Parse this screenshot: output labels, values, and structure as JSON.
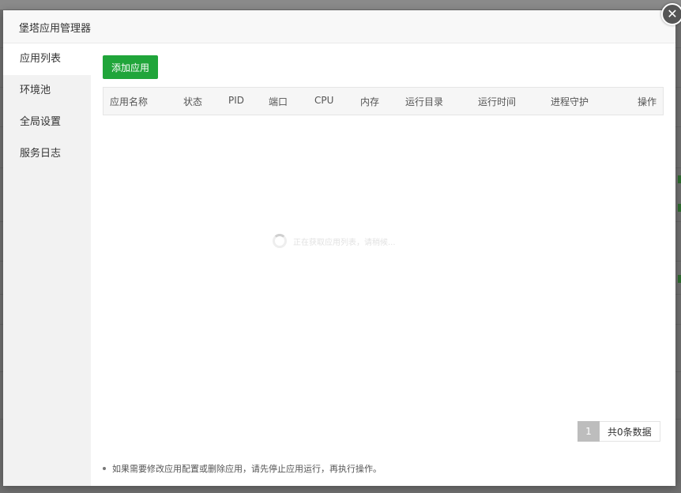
{
  "modal": {
    "title": "堡塔应用管理器",
    "close_glyph": "✕"
  },
  "sidebar": {
    "items": [
      {
        "label": "应用列表"
      },
      {
        "label": "环境池"
      },
      {
        "label": "全局设置"
      },
      {
        "label": "服务日志"
      }
    ],
    "active_index": 0
  },
  "toolbar": {
    "add_label": "添加应用"
  },
  "table": {
    "columns": [
      "应用名称",
      "状态",
      "PID",
      "端口",
      "CPU",
      "内存",
      "运行目录",
      "运行时间",
      "进程守护",
      "操作"
    ]
  },
  "loading": {
    "text": "正在获取应用列表，请稍候..."
  },
  "pagination": {
    "current_page": "1",
    "total_text": "共0条数据"
  },
  "notice": {
    "text": "如果需要修改应用配置或删除应用，请先停止应用运行，再执行操作。"
  },
  "colors": {
    "primary": "#20a53a",
    "overlay": "#6f6f6f"
  }
}
